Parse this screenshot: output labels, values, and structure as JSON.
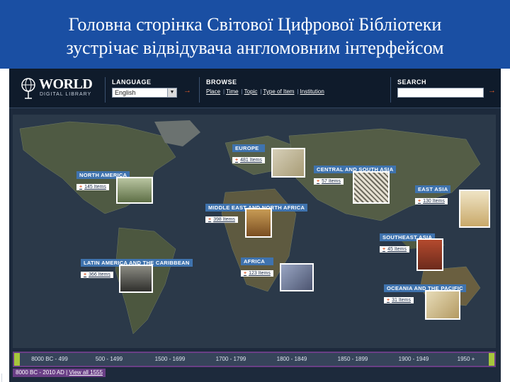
{
  "slide": {
    "title_line1": "Головна сторінка Світової Цифрової Бібліотеки",
    "title_line2": "зустрічає відвідувача англомовним інтерфейсом"
  },
  "header": {
    "logo_main": "WORLD",
    "logo_sub": "DIGITAL LIBRARY",
    "language_label": "LANGUAGE",
    "language_value": "English",
    "browse_label": "BROWSE",
    "browse_links": [
      "Place",
      "Time",
      "Topic",
      "Type of Item",
      "Institution"
    ],
    "search_label": "SEARCH",
    "go_arrow": "→"
  },
  "regions": [
    {
      "name": "EUROPE",
      "items": "481 Items"
    },
    {
      "name": "CENTRAL AND SOUTH ASIA",
      "items": "57 Items"
    },
    {
      "name": "NORTH AMERICA",
      "items": "145 Items"
    },
    {
      "name": "EAST ASIA",
      "items": "130 Items"
    },
    {
      "name": "MIDDLE EAST AND NORTH AFRICA",
      "items": "398 Items"
    },
    {
      "name": "SOUTHEAST ASIA",
      "items": "45 Items"
    },
    {
      "name": "LATIN AMERICA AND THE CARIBBEAN",
      "items": "366 Items"
    },
    {
      "name": "AFRICA",
      "items": "123 Items"
    },
    {
      "name": "OCEANIA AND THE PACIFIC",
      "items": "31 Items"
    }
  ],
  "timeline": {
    "segments": [
      "8000 BC - 499",
      "500 - 1499",
      "1500 - 1699",
      "1700 - 1799",
      "1800 - 1849",
      "1850 - 1899",
      "1900 - 1949",
      "1950 +"
    ],
    "range_text": "8000 BC - 2010 AD",
    "view_all": "View all 1555"
  },
  "colors": {
    "title_bg": "#1a4fa3",
    "region_header": "#3f73ae",
    "accent_arrow": "#e05a2a",
    "timeline_border": "#6a3f86",
    "timeline_cap": "#a6c63c"
  }
}
